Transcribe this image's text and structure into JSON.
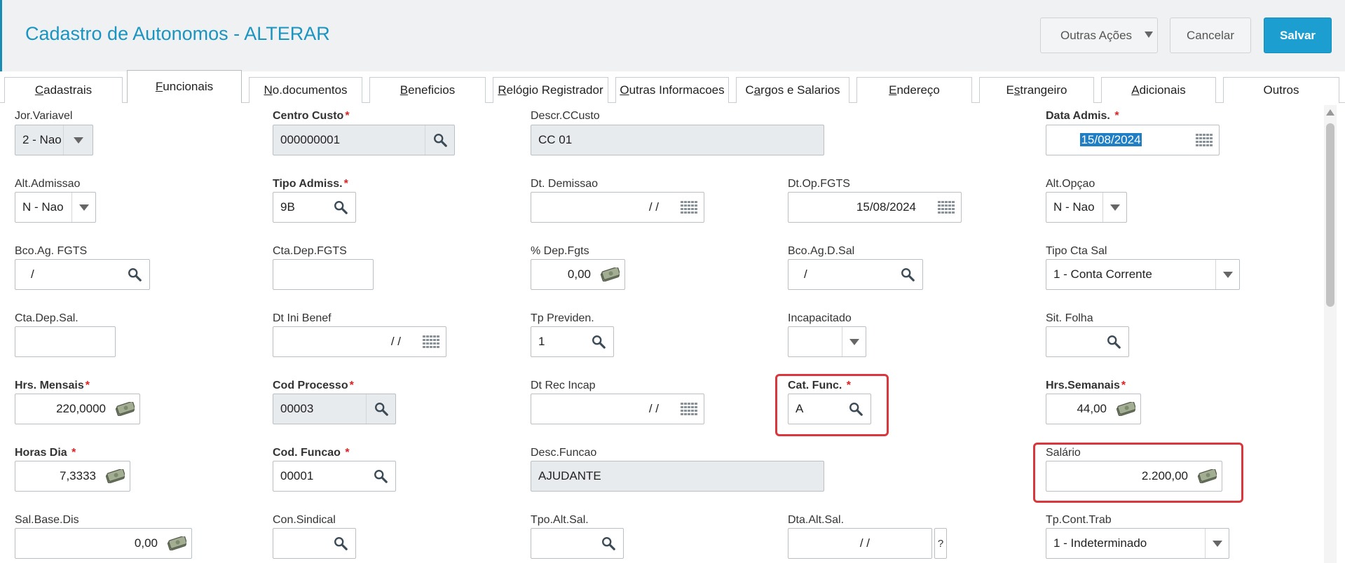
{
  "header": {
    "title": "Cadastro de Autonomos - ALTERAR",
    "outras_label": "Outras Ações",
    "cancel_label": "Cancelar",
    "save_label": "Salvar"
  },
  "tabs": [
    {
      "label": "Cadastrais",
      "underline": "C"
    },
    {
      "label": "Funcionais",
      "underline": "F"
    },
    {
      "label": "No.documentos",
      "underline": "N"
    },
    {
      "label": "Beneficios",
      "underline": "B"
    },
    {
      "label": "Relógio Registrador",
      "underline": "R"
    },
    {
      "label": "Outras Informacoes",
      "underline": "O"
    },
    {
      "label": "Cargos e Salarios",
      "underline": "a"
    },
    {
      "label": "Endereço",
      "underline": "E"
    },
    {
      "label": "Estrangeiro",
      "underline": "s"
    },
    {
      "label": "Adicionais",
      "underline": "A"
    },
    {
      "label": "Outros",
      "underline": ""
    }
  ],
  "fields": {
    "jor_variavel": {
      "label": "Jor.Variavel",
      "value": "2 - Nao"
    },
    "centro_custo": {
      "label": "Centro Custo",
      "value": "000000001"
    },
    "descr_ccusto": {
      "label": "Descr.CCusto",
      "value": "CC 01"
    },
    "data_admis": {
      "label": "Data Admis. ",
      "value": "15/08/2024"
    },
    "alt_admissao": {
      "label": "Alt.Admissao",
      "value": "N - Nao"
    },
    "tipo_admiss": {
      "label": "Tipo Admiss.",
      "value": "9B"
    },
    "dt_demissao": {
      "label": "Dt. Demissao",
      "value": "/  /"
    },
    "dt_op_fgts": {
      "label": "Dt.Op.FGTS",
      "value": "15/08/2024"
    },
    "alt_opcao": {
      "label": "Alt.Opçao",
      "value": "N - Nao"
    },
    "bco_ag_fgts": {
      "label": "Bco.Ag. FGTS",
      "value": "/"
    },
    "cta_dep_fgts": {
      "label": "Cta.Dep.FGTS",
      "value": ""
    },
    "pct_dep_fgts": {
      "label": "% Dep.Fgts",
      "value": "0,00"
    },
    "bco_ag_d_sal": {
      "label": "Bco.Ag.D.Sal",
      "value": "/"
    },
    "tipo_cta_sal": {
      "label": "Tipo Cta Sal",
      "value": "1 - Conta Corrente"
    },
    "cta_dep_sal": {
      "label": "Cta.Dep.Sal.",
      "value": ""
    },
    "dt_ini_benef": {
      "label": "Dt Ini Benef",
      "value": "/  /"
    },
    "tp_previden": {
      "label": "Tp Previden.",
      "value": "1"
    },
    "incapacitado": {
      "label": "Incapacitado",
      "value": ""
    },
    "sit_folha": {
      "label": "Sit. Folha",
      "value": ""
    },
    "hrs_mensais": {
      "label": "Hrs. Mensais",
      "value": "220,0000"
    },
    "cod_processo": {
      "label": "Cod Processo",
      "value": "00003"
    },
    "dt_rec_incap": {
      "label": "Dt Rec Incap",
      "value": "/  /"
    },
    "cat_func": {
      "label": "Cat. Func. ",
      "value": "A"
    },
    "hrs_semanais": {
      "label": "Hrs.Semanais",
      "value": "44,00"
    },
    "horas_dia": {
      "label": "Horas Dia ",
      "value": "7,3333"
    },
    "cod_funcao": {
      "label": "Cod. Funcao ",
      "value": "00001"
    },
    "desc_funcao": {
      "label": "Desc.Funcao",
      "value": "AJUDANTE"
    },
    "salario": {
      "label": "Salário",
      "value": "2.200,00"
    },
    "sal_base_dis": {
      "label": "Sal.Base.Dis",
      "value": "0,00"
    },
    "con_sindical": {
      "label": "Con.Sindical",
      "value": ""
    },
    "tpo_alt_sal": {
      "label": "Tpo.Alt.Sal.",
      "value": ""
    },
    "dta_alt_sal": {
      "label": "Dta.Alt.Sal.",
      "value": "/  /"
    },
    "dta_alt_sal_help": "?",
    "tp_cont_trab": {
      "label": "Tp.Cont.Trab",
      "value": "1 - Indeterminado"
    }
  },
  "required_marker": "*",
  "colors": {
    "accent": "#1a94c1",
    "primary_button": "#1c9fd0",
    "required": "#e02020",
    "highlight": "#d9363e"
  }
}
